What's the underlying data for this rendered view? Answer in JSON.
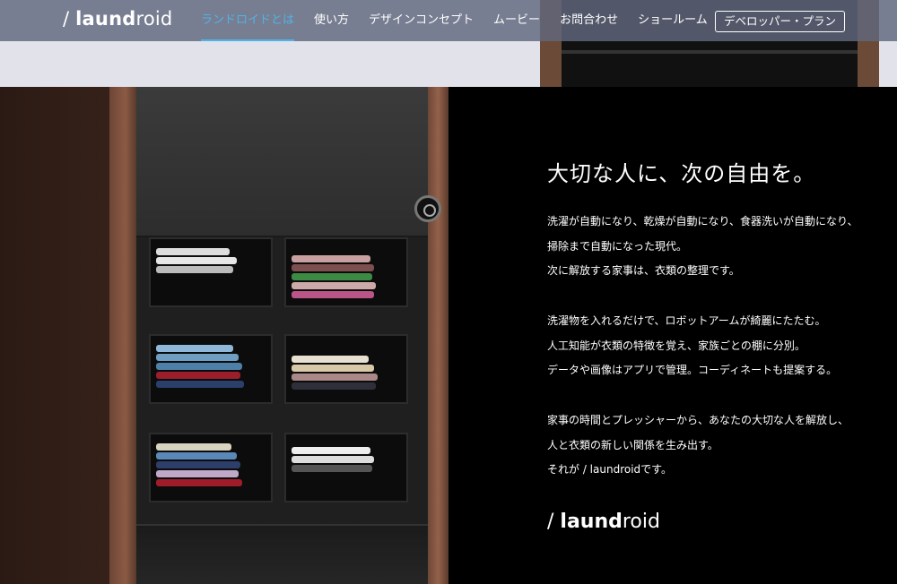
{
  "header": {
    "logo": {
      "prefix": "/ ",
      "bold": "laund",
      "rest": "roid"
    },
    "nav": [
      {
        "label": "ランドロイドとは",
        "active": true
      },
      {
        "label": "使い方"
      },
      {
        "label": "デザインコンセプト"
      },
      {
        "label": "ムービー"
      },
      {
        "label": "お問合わせ"
      },
      {
        "label": "ショールーム"
      }
    ],
    "developer_button": "デベロッパー・プラン"
  },
  "content": {
    "headline": "大切な人に、次の自由を。",
    "paragraph1": [
      "洗濯が自動になり、乾燥が自動になり、食器洗いが自動になり、",
      "掃除まで自動になった現代。",
      "次に解放する家事は、衣類の整理です。"
    ],
    "paragraph2": [
      "洗濯物を入れるだけで、ロボットアームが綺麗にたたむ。",
      "人工知能が衣類の特徴を覚え、家族ごとの棚に分別。",
      "データや画像はアプリで管理。コーディネートも提案する。"
    ],
    "paragraph3": [
      "家事の時間とプレッシャーから、あなたの大切な人を解放し、",
      "人と衣類の新しい関係を生み出す。",
      "それが / laundroidです。"
    ],
    "footer_logo": {
      "prefix": "/ ",
      "bold": "laund",
      "rest": "roid"
    }
  },
  "colors": {
    "accent": "#4fb3e8",
    "nav_bg": "#60687e",
    "panel_bg": "#000000",
    "wood": "#8b5a45"
  }
}
